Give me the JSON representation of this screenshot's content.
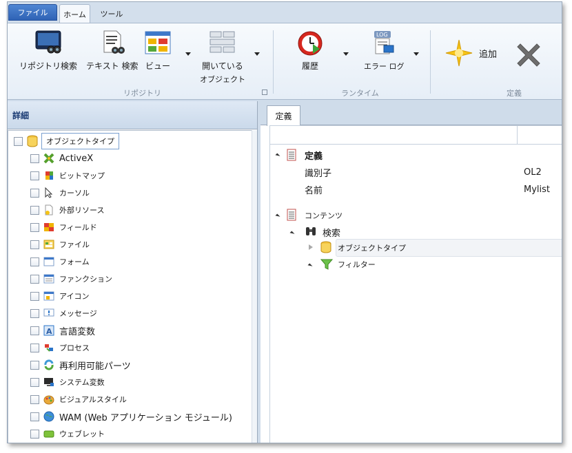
{
  "tabs": {
    "file": "ファイル",
    "home": "ホーム",
    "tools": "ツール"
  },
  "ribbon": {
    "repository_search": "リポジトリ検索",
    "text_search": "テキスト 検索",
    "view": "ビュー",
    "open_objects_line1": "開いている",
    "open_objects_line2": "オブジェクト",
    "history": "履歴",
    "error_log": "エラー ログ",
    "add": "追加",
    "group_repository": "リポジトリ",
    "group_runtime": "ランタイム",
    "group_definition": "定義"
  },
  "left_panel": {
    "title": "詳細",
    "root_label": "オブジェクトタイプ",
    "items": [
      {
        "label": "ActiveX",
        "icon": "activex-icon"
      },
      {
        "label": "ビットマップ",
        "icon": "bitmap-icon"
      },
      {
        "label": "カーソル",
        "icon": "cursor-icon"
      },
      {
        "label": "外部リソース",
        "icon": "external-resource-icon"
      },
      {
        "label": "フィールド",
        "icon": "field-icon"
      },
      {
        "label": "ファイル",
        "icon": "file-icon"
      },
      {
        "label": "フォーム",
        "icon": "form-icon"
      },
      {
        "label": "ファンクション",
        "icon": "function-icon"
      },
      {
        "label": "アイコン",
        "icon": "icon-icon"
      },
      {
        "label": "メッセージ",
        "icon": "message-icon"
      },
      {
        "label": "言語変数",
        "icon": "language-variable-icon"
      },
      {
        "label": "プロセス",
        "icon": "process-icon"
      },
      {
        "label": "再利用可能パーツ",
        "icon": "reusable-part-icon"
      },
      {
        "label": "システム変数",
        "icon": "system-variable-icon"
      },
      {
        "label": "ビジュアルスタイル",
        "icon": "visual-style-icon"
      },
      {
        "label": "WAM (Web アプリケーション モジュール)",
        "icon": "wam-icon"
      },
      {
        "label": "ウェブレット",
        "icon": "weblet-icon"
      }
    ]
  },
  "right_panel": {
    "tab": "定義",
    "definition_header": "定義",
    "id_label": "識別子",
    "id_value": "OL2",
    "name_label": "名前",
    "name_value": "Mylist",
    "contents_header": "コンテンツ",
    "search_label": "検索",
    "object_type_label": "オブジェクトタイプ",
    "filter_label": "フィルター"
  }
}
